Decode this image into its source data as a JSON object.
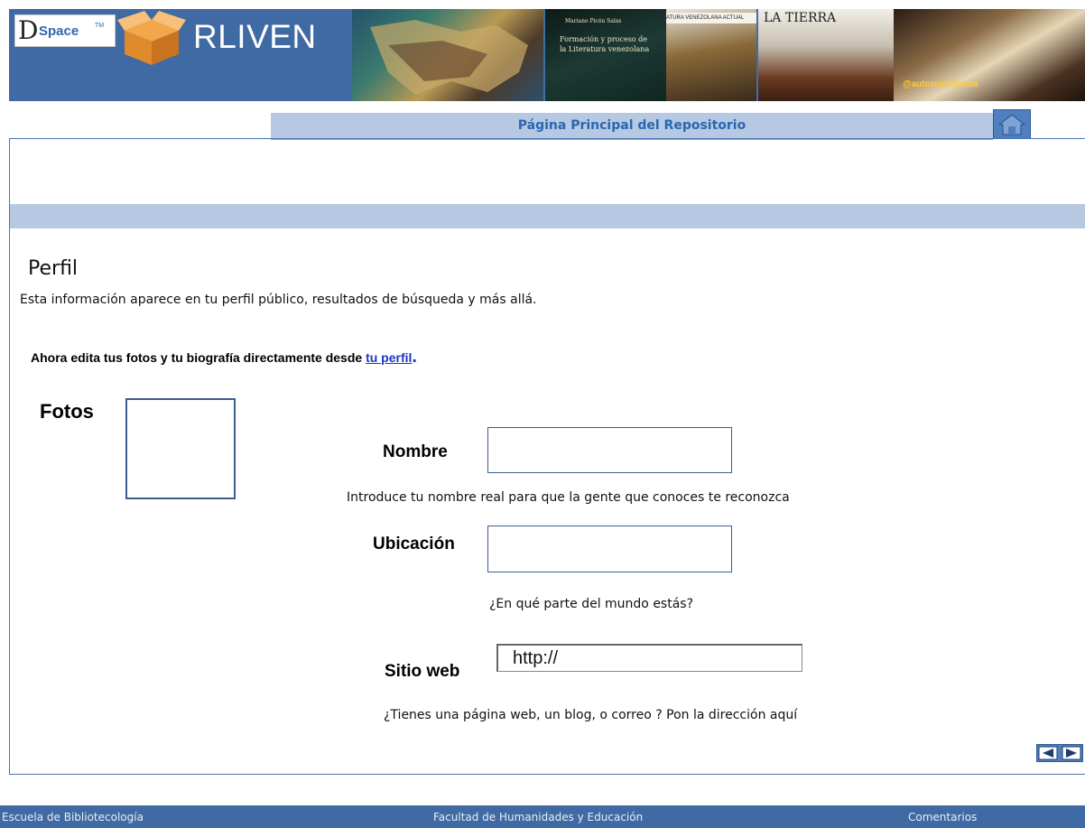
{
  "banner": {
    "dspace_d": "D",
    "dspace_space": "Space",
    "dspace_tm": "TM",
    "site_name": "RLIVEN",
    "photo_texts": {
      "book_title": "Formación y proceso de la Literatura venezolana",
      "book_author": "Mariano Picón Salas",
      "shelf_caption": "ATURA VENEZOLANA ACTUAL",
      "novel_title": "LA TIERRA",
      "twitter_handle": "@autoresVzlanos"
    },
    "brand_color": "#3f6aa3"
  },
  "nav": {
    "title": "Página Principal del Repositorio",
    "home_icon": "home-icon"
  },
  "profile": {
    "heading": "Perfil",
    "description": "Esta información aparece en tu perfil público, resultados de búsqueda y más allá.",
    "notice_prefix": "Ahora edita tus fotos y tu biografía directamente desde ",
    "notice_link": "tu perfil",
    "notice_suffix": "."
  },
  "form": {
    "photos_label": "Fotos",
    "name": {
      "label": "Nombre",
      "value": "",
      "hint": "Introduce tu nombre real para que la gente que conoces te reconozca"
    },
    "location": {
      "label": "Ubicación",
      "value": "",
      "hint": "¿En qué parte del mundo estás?"
    },
    "website": {
      "label": "Sitio web",
      "value": "http://",
      "hint": "¿Tienes una página web, un blog, o correo ? Pon la dirección  aquí"
    }
  },
  "pager": {
    "icon": "prev-next-icon"
  },
  "footer": {
    "left": "Escuela de Bibliotecología",
    "center": "Facultad de Humanidades y Educación",
    "right": "Comentarios"
  }
}
